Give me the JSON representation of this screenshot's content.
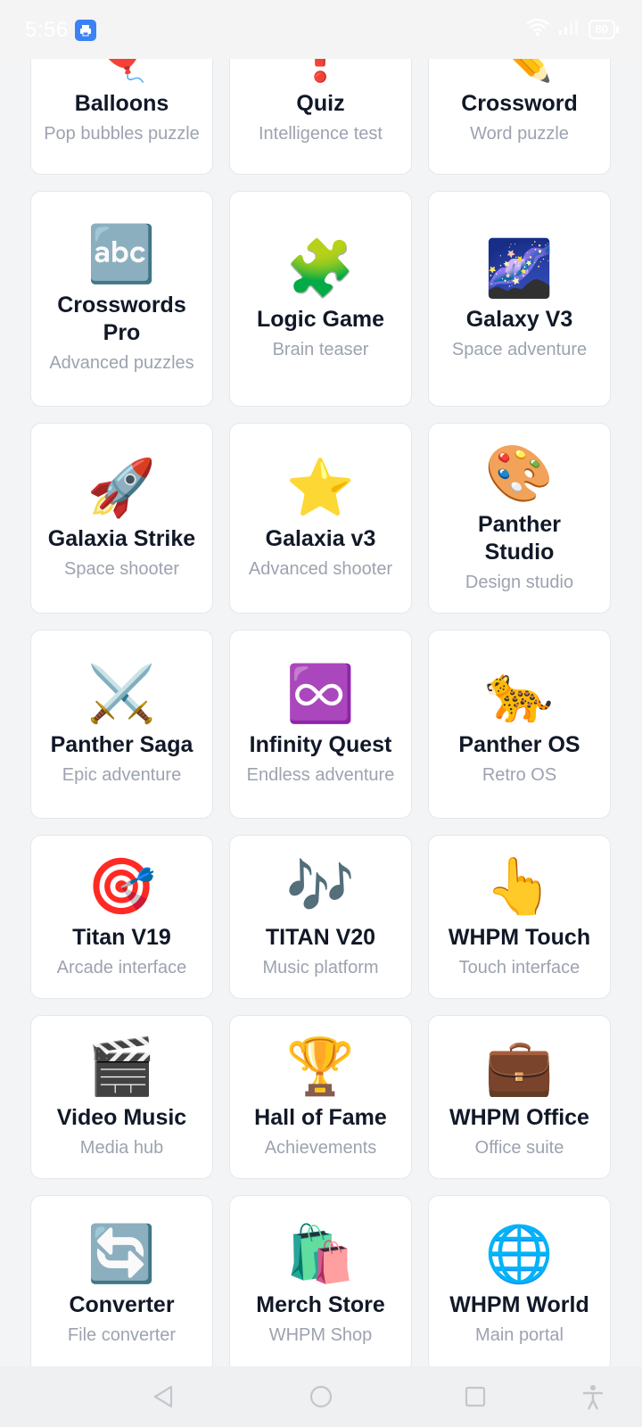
{
  "status": {
    "time": "5:56",
    "battery": "80"
  },
  "apps": [
    {
      "icon": "🎈",
      "title": "Balloons",
      "subtitle": "Pop bubbles puzzle"
    },
    {
      "icon": "❗",
      "title": "Quiz",
      "subtitle": "Intelligence test"
    },
    {
      "icon": "✏️",
      "title": "Crossword",
      "subtitle": "Word puzzle"
    },
    {
      "icon": "🔤",
      "title": "Crosswords Pro",
      "subtitle": "Advanced puzzles"
    },
    {
      "icon": "🧩",
      "title": "Logic Game",
      "subtitle": "Brain teaser"
    },
    {
      "icon": "🌌",
      "title": "Galaxy V3",
      "subtitle": "Space adventure"
    },
    {
      "icon": "🚀",
      "title": "Galaxia Strike",
      "subtitle": "Space shooter"
    },
    {
      "icon": "⭐",
      "title": "Galaxia v3",
      "subtitle": "Advanced shooter"
    },
    {
      "icon": "🎨",
      "title": "Panther Studio",
      "subtitle": "Design studio"
    },
    {
      "icon": "⚔️",
      "title": "Panther Saga",
      "subtitle": "Epic adventure"
    },
    {
      "icon": "♾️",
      "title": "Infinity Quest",
      "subtitle": "Endless adventure"
    },
    {
      "icon": "🐆",
      "title": "Panther OS",
      "subtitle": "Retro OS"
    },
    {
      "icon": "🎯",
      "title": "Titan V19",
      "subtitle": "Arcade interface"
    },
    {
      "icon": "🎶",
      "title": "TITAN V20",
      "subtitle": "Music platform"
    },
    {
      "icon": "👆",
      "title": "WHPM Touch",
      "subtitle": "Touch interface"
    },
    {
      "icon": "🎬",
      "title": "Video Music",
      "subtitle": "Media hub"
    },
    {
      "icon": "🏆",
      "title": "Hall of Fame",
      "subtitle": "Achievements"
    },
    {
      "icon": "💼",
      "title": "WHPM Office",
      "subtitle": "Office suite"
    },
    {
      "icon": "🔄",
      "title": "Converter",
      "subtitle": "File converter"
    },
    {
      "icon": "🛍️",
      "title": "Merch Store",
      "subtitle": "WHPM Shop"
    },
    {
      "icon": "🌐",
      "title": "WHPM World",
      "subtitle": "Main portal"
    }
  ]
}
